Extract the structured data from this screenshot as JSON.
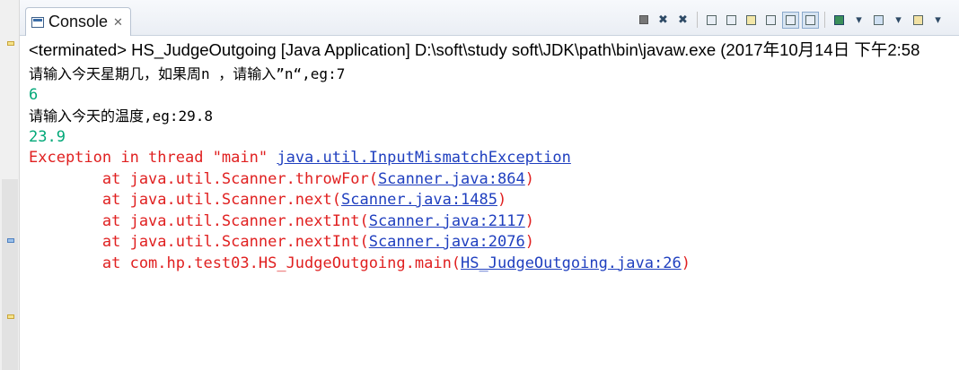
{
  "tab": {
    "label": "Console",
    "close": "✕"
  },
  "header": "<terminated> HS_JudgeOutgoing [Java Application] D:\\soft\\study soft\\JDK\\path\\bin\\javaw.exe (2017年10月14日 下午2:58",
  "output": {
    "prompt1": "请输入今天星期几，如果周n ，请输入”n“,eg:7",
    "input1": "6",
    "prompt2": "请输入今天的温度,eg:29.8",
    "input2": "23.9",
    "exception_prefix": "Exception in thread \"main\" ",
    "exception_class": "java.util.InputMismatchException",
    "frames": [
      {
        "text": "        at java.util.Scanner.throwFor(",
        "link": "Scanner.java:864",
        "end": ")"
      },
      {
        "text": "        at java.util.Scanner.next(",
        "link": "Scanner.java:1485",
        "end": ")"
      },
      {
        "text": "        at java.util.Scanner.nextInt(",
        "link": "Scanner.java:2117",
        "end": ")"
      },
      {
        "text": "        at java.util.Scanner.nextInt(",
        "link": "Scanner.java:2076",
        "end": ")"
      },
      {
        "text": "        at com.hp.test03.HS_JudgeOutgoing.main(",
        "link": "HS_JudgeOutgoing.java:26",
        "end": ")"
      }
    ]
  },
  "icons": [
    "terminate-icon",
    "remove-launch-icon",
    "remove-all-terminated-icon",
    "scroll-lock-icon",
    "word-wrap-icon",
    "clear-console-icon",
    "show-on-stdout-icon",
    "show-on-stderr-icon",
    "pin-console-icon",
    "display-console-icon",
    "open-console-icon"
  ]
}
